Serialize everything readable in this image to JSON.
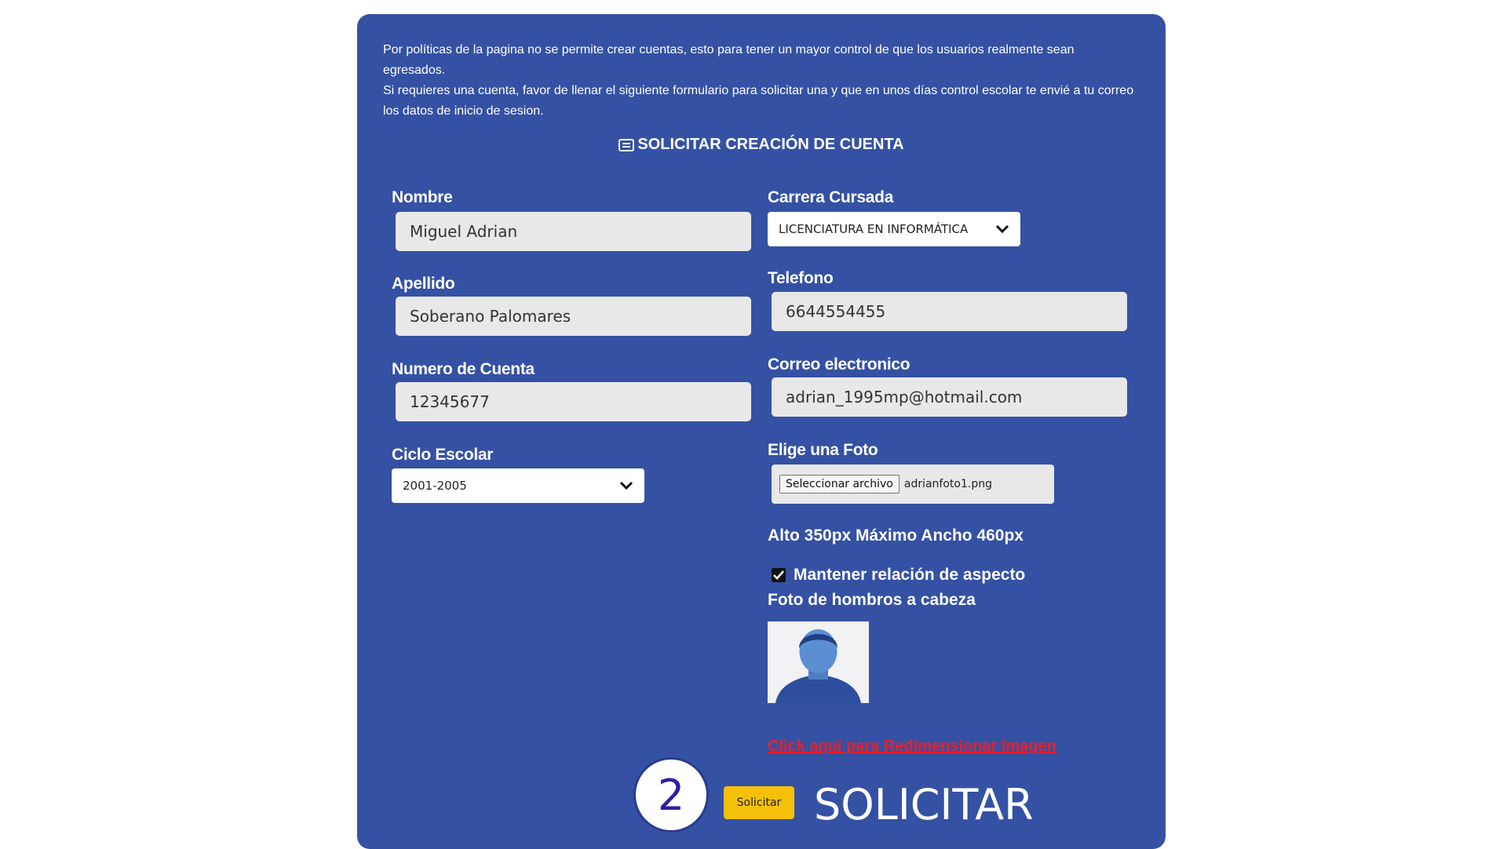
{
  "intro": {
    "line1": "Por políticas de la pagina no se permite crear cuentas, esto para tener un mayor control de que los usuarios realmente sean egresados.",
    "line2": "Si requieres una cuenta, favor de llenar el siguiente formulario para solicitar una y que en unos días control escolar te envié a tu correo los datos de inicio de sesion."
  },
  "section_title": "SOLICITAR CREACIÓN DE CUENTA",
  "form": {
    "nombre": {
      "label": "Nombre",
      "value": "Miguel Adrian"
    },
    "apellido": {
      "label": "Apellido",
      "value": "Soberano Palomares"
    },
    "numero_cuenta": {
      "label": "Numero de Cuenta",
      "value": "12345677"
    },
    "ciclo_escolar": {
      "label": "Ciclo Escolar",
      "value": "2001-2005"
    },
    "carrera": {
      "label": "Carrera Cursada",
      "value": "LICENCIATURA EN INFORMÁTICA"
    },
    "telefono": {
      "label": "Telefono",
      "value": "6644554455"
    },
    "correo": {
      "label": "Correo electronico",
      "value": "adrian_1995mp@hotmail.com"
    },
    "foto": {
      "label": "Elige una Foto",
      "button": "Seleccionar archivo",
      "filename": "adrianfoto1.png"
    }
  },
  "photo_notes": {
    "size": "Alto 350px Máximo Ancho 460px",
    "aspect": "Mantener relación de aspecto",
    "aspect_checked": true,
    "framing": "Foto de hombros a cabeza"
  },
  "resize_link": "Click aquí para Redimensionar Imagen",
  "step_number": "2",
  "submit_button": "Solicitar",
  "big_label": "SOLICITAR",
  "colors": {
    "panel": "#3451a3",
    "submit": "#f5c009",
    "link": "#e8202a"
  }
}
